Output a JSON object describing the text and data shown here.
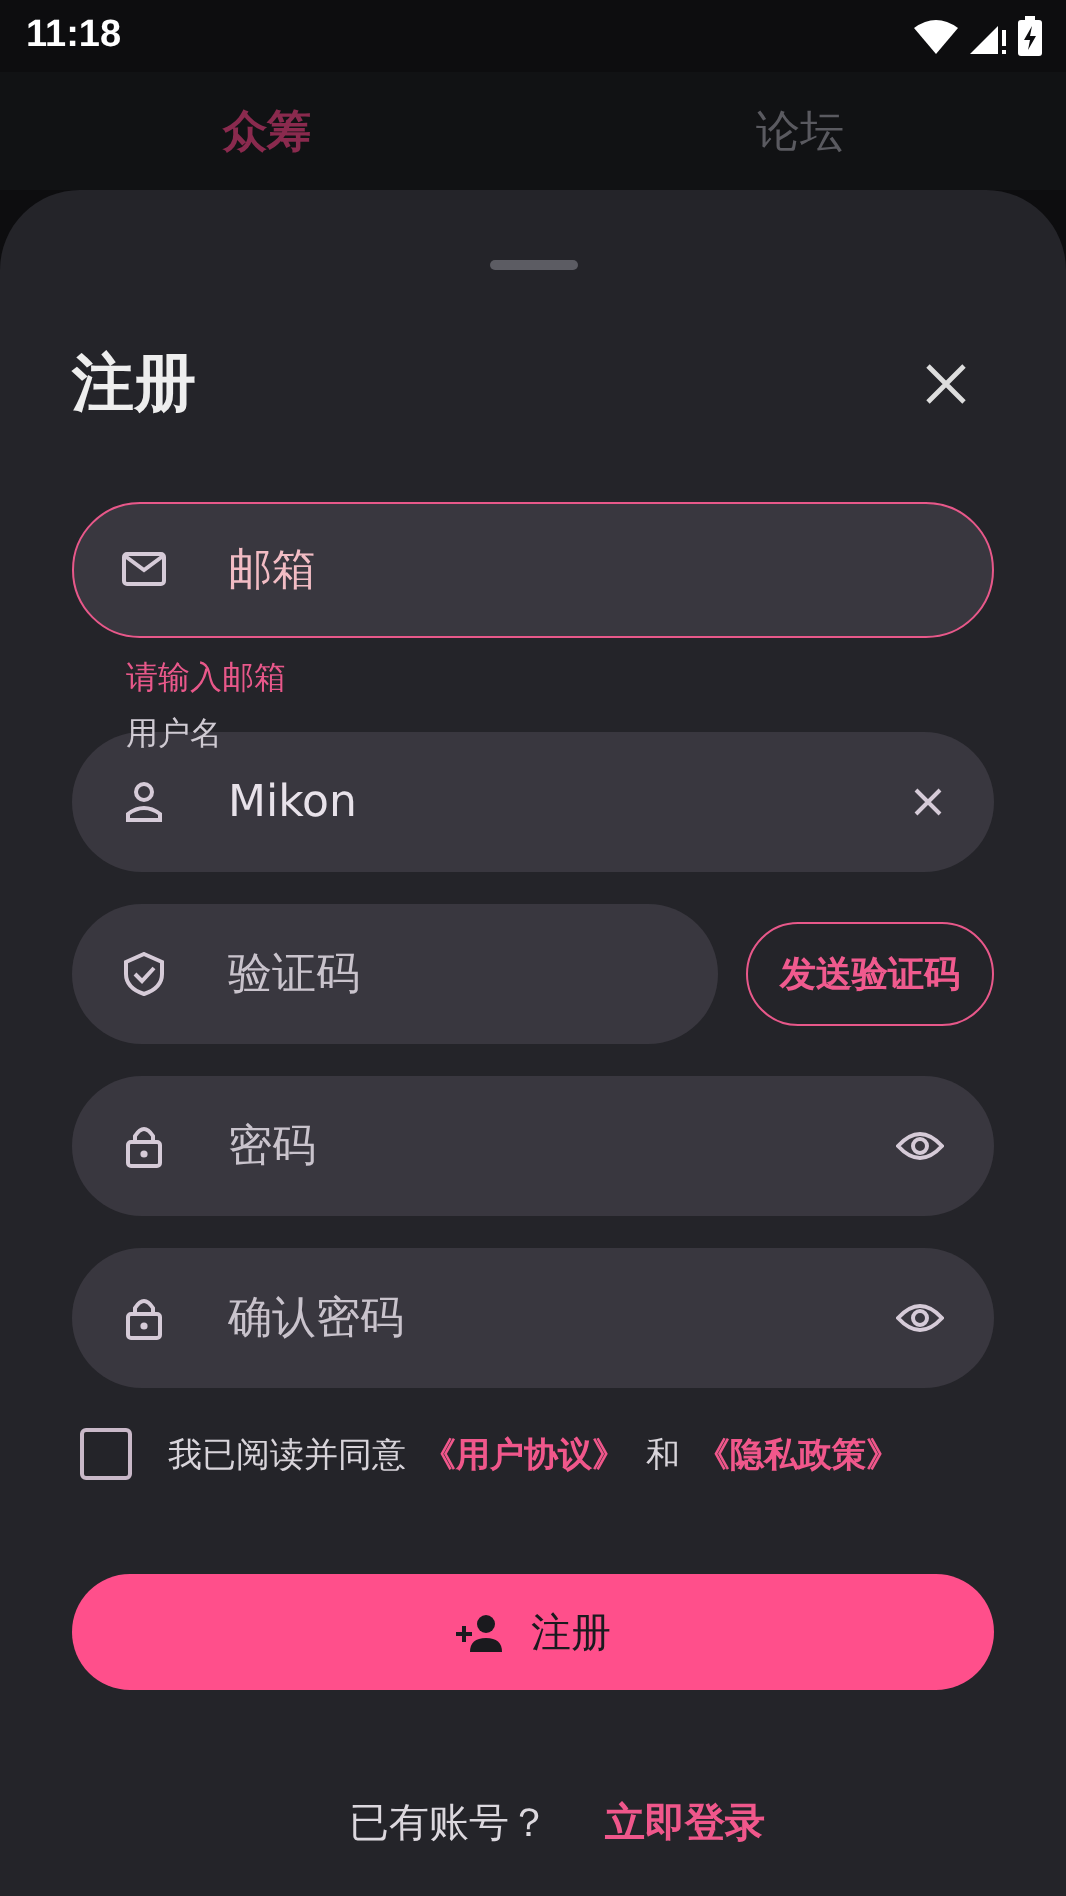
{
  "status_bar": {
    "time": "11:18"
  },
  "tabs": [
    {
      "label": "众筹",
      "selected": true
    },
    {
      "label": "论坛",
      "selected": false
    }
  ],
  "sheet": {
    "title": "注册",
    "fields": [
      {
        "kind": "email",
        "placeholder": "邮箱",
        "error": true,
        "error_text": "请输入邮箱"
      },
      {
        "kind": "username",
        "label": "用户名",
        "value": "Mikon",
        "error": false
      },
      {
        "kind": "code",
        "placeholder": "验证码",
        "button": "发送验证码",
        "error": false
      },
      {
        "kind": "password",
        "placeholder": "密码",
        "error": false
      },
      {
        "kind": "password",
        "placeholder": "确认密码",
        "error": false
      }
    ],
    "agreement": {
      "checked": false,
      "text": "我已阅读并同意",
      "link_1": "《用户协议》",
      "joiner": "和",
      "link_2": "《隐私政策》"
    },
    "submit": "注册",
    "footer": {
      "text": "已有账号？",
      "link": "立即登录"
    }
  }
}
